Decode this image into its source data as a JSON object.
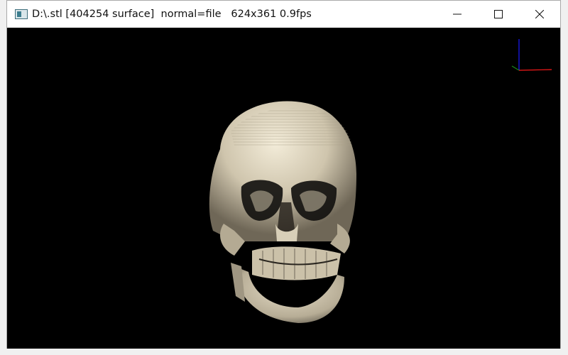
{
  "window": {
    "title": "D:\\.stl [404254 surface]  normal=file   624x361 0.9fps"
  },
  "controls": {
    "minimize": "minimize",
    "maximize": "maximize",
    "close": "close"
  },
  "colors": {
    "background": "#000000",
    "surface": "#cfc5ad",
    "axis_x": "#ff0000",
    "axis_y": "#0000ff"
  }
}
